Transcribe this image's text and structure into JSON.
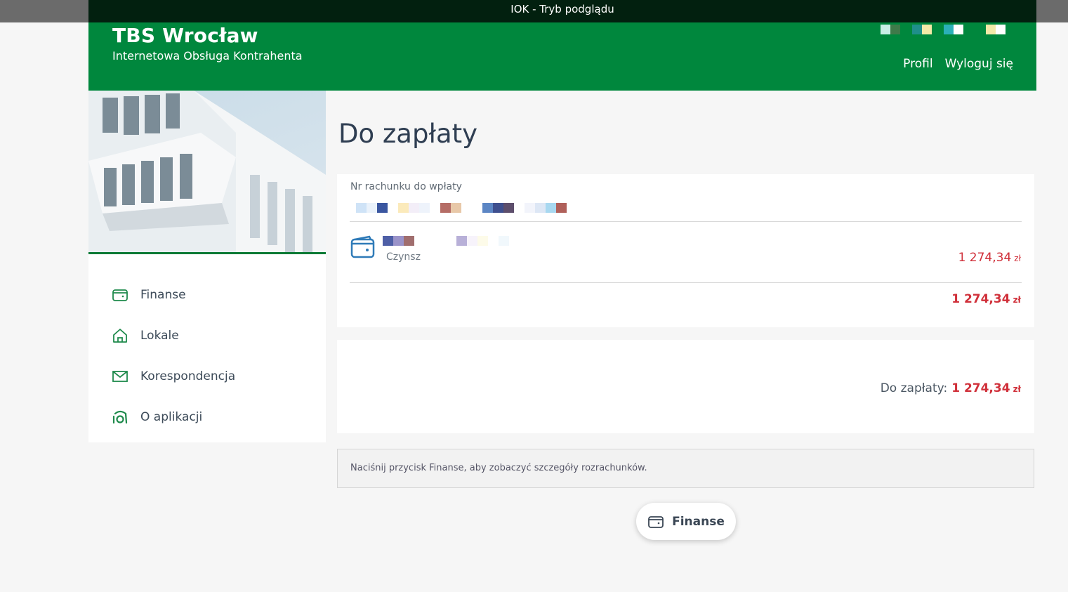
{
  "preview_bar": {
    "text": "IOK - Tryb podglądu"
  },
  "header": {
    "title": "TBS Wrocław",
    "subtitle": "Internetowa Obsługa Kontrahenta",
    "links": {
      "profile": "Profil",
      "logout": "Wyloguj się"
    }
  },
  "sidebar": {
    "items": [
      {
        "label": "Finanse",
        "icon": "wallet-icon"
      },
      {
        "label": "Lokale",
        "icon": "home-icon"
      },
      {
        "label": "Korespondencja",
        "icon": "envelope-icon"
      },
      {
        "label": "O aplikacji",
        "icon": "info-icon"
      }
    ]
  },
  "main": {
    "title": "Do zapłaty",
    "account_label": "Nr rachunku do wpłaty",
    "item": {
      "name": "Czynsz",
      "amount": "1 274,34",
      "currency": "zł"
    },
    "sum": {
      "amount": "1 274,34",
      "currency": "zł"
    },
    "total": {
      "label": "Do zapłaty:",
      "amount": "1 274,34",
      "currency": "zł"
    },
    "info": "Naciśnij przycisk Finanse, aby zobaczyć szczegóły rozrachunków.",
    "finanse_button": "Finanse"
  },
  "colors": {
    "brand_green": "#00873d",
    "amount_red": "#d0303a",
    "dark_bar": "#02200f"
  }
}
